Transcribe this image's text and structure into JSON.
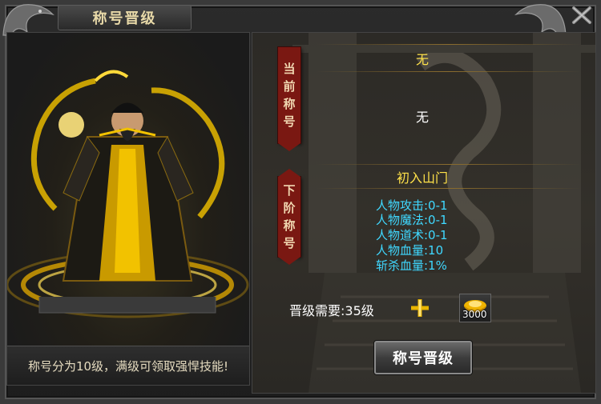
{
  "window": {
    "title": "称号晋级"
  },
  "left": {
    "description": "称号分为10级，满级可领取强悍技能!"
  },
  "current": {
    "label_chars": [
      "当",
      "前",
      "称",
      "号"
    ],
    "title": "无",
    "attributes": "无"
  },
  "next": {
    "label_chars": [
      "下",
      "阶",
      "称",
      "号"
    ],
    "title": "初入山门",
    "stats": [
      "人物攻击:0-1",
      "人物魔法:0-1",
      "人物道术:0-1",
      "人物血量:10",
      "斩杀血量:1%"
    ]
  },
  "requirement": {
    "text": "晋级需要:35级",
    "gold_amount": "3000"
  },
  "button": {
    "label": "称号晋级"
  },
  "colors": {
    "accent_gold": "#ffe24a",
    "stat_cyan": "#3fd8ff",
    "label_red": "#7a1812"
  }
}
